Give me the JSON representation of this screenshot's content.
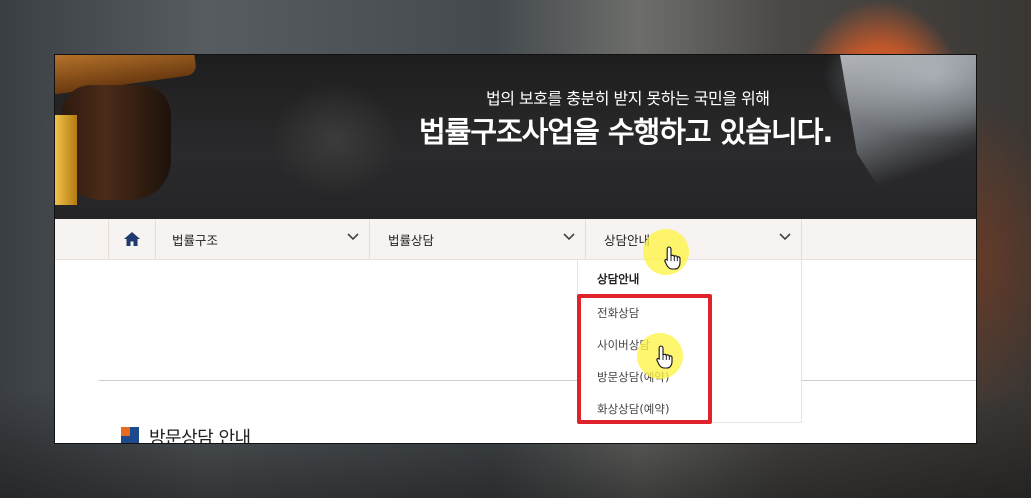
{
  "banner": {
    "subtitle": "법의 보호를 충분히 받지 못하는 국민을 위해",
    "title": "법률구조사업을 수행하고 있습니다."
  },
  "nav": {
    "home_icon": "home-icon",
    "items": [
      {
        "label": "법률구조"
      },
      {
        "label": "법률상담"
      },
      {
        "label": "상담안내"
      }
    ]
  },
  "dropdown": {
    "heading": "상담안내",
    "items": [
      "전화상담",
      "사이버상담",
      "방문상담(예약)",
      "화상상담(예약)"
    ]
  },
  "section": {
    "title": "방문상담 안내"
  },
  "colors": {
    "highlight_box": "#e0232b",
    "cursor_highlight": "#fff446",
    "accent_orange": "#e66a1f",
    "accent_blue": "#1c4a8c"
  }
}
